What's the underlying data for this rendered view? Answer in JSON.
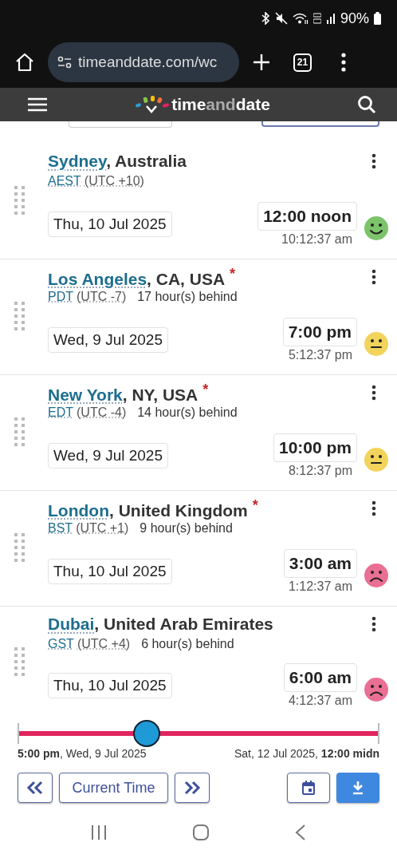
{
  "status_bar": {
    "battery": "90%"
  },
  "browser": {
    "url": "timeanddate.com/wc",
    "tab_count": "21"
  },
  "site_header": {
    "brand": [
      "time",
      "and",
      "date"
    ]
  },
  "locations": [
    {
      "city": "Sydney",
      "region": ", Australia",
      "zone": "AEST",
      "utc": "(UTC +10)",
      "date": "Thu, 10 Jul 2025",
      "time": "12:00 noon",
      "current": "10:12:37 am",
      "kind": "happy",
      "color": "#7cc36a"
    },
    {
      "city": "Los Angeles",
      "region": ", CA, USA",
      "note_mark": "*",
      "zone": "PDT",
      "utc": "(UTC -7)",
      "offset": "17 hour(s) behind",
      "date": "Wed, 9 Jul 2025",
      "time": "7:00 pm",
      "current": "5:12:37 pm",
      "kind": "neutral",
      "color": "#f2d45c"
    },
    {
      "city": "New York",
      "region": ", NY, USA",
      "note_mark": "*",
      "zone": "EDT",
      "utc": "(UTC -4)",
      "offset": "14 hour(s) behind",
      "date": "Wed, 9 Jul 2025",
      "time": "10:00 pm",
      "current": "8:12:37 pm",
      "kind": "neutral",
      "color": "#f2d45c"
    },
    {
      "city": "London",
      "region": ", United Kingdom",
      "note_mark": "*",
      "zone": "BST",
      "utc": "(UTC +1)",
      "offset": "9 hour(s) behind",
      "date": "Thu, 10 Jul 2025",
      "time": "3:00 am",
      "current": "1:12:37 am",
      "kind": "sad",
      "color": "#ea6f94"
    },
    {
      "city": "Dubai",
      "region": ", United Arab Emirates",
      "zone": "GST",
      "utc": "(UTC +4)",
      "offset": "6 hour(s) behind",
      "date": "Thu, 10 Jul 2025",
      "time": "6:00 am",
      "current": "4:12:37 am",
      "kind": "sad",
      "color": "#ea6f94"
    }
  ],
  "time_slider": {
    "level": 0.355,
    "start_label": "**5:00 pm**, Wed, 9 Jul 2025",
    "end_label": "Sat, 12 Jul 2025, **12:00 midn**"
  },
  "controls": {
    "current_time_button": "Current Time"
  }
}
